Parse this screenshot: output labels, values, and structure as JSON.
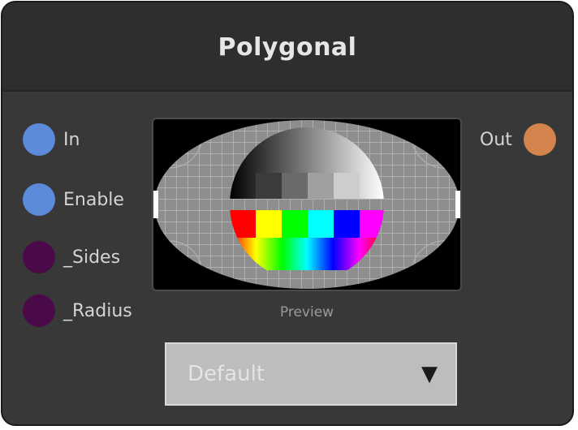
{
  "node": {
    "title": "Polygonal"
  },
  "inputs": [
    {
      "label": "In",
      "color": "#5b8bd9"
    },
    {
      "label": "Enable",
      "color": "#5b8bd9"
    },
    {
      "label": "_Sides",
      "color": "#4a0a4a"
    },
    {
      "label": "_Radius",
      "color": "#4a0a4a"
    }
  ],
  "outputs": [
    {
      "label": "Out",
      "color": "#d4844c"
    }
  ],
  "preview": {
    "caption": "Preview"
  },
  "dropdown": {
    "value": "Default",
    "arrow_icon": "dropdown-arrow-icon"
  }
}
